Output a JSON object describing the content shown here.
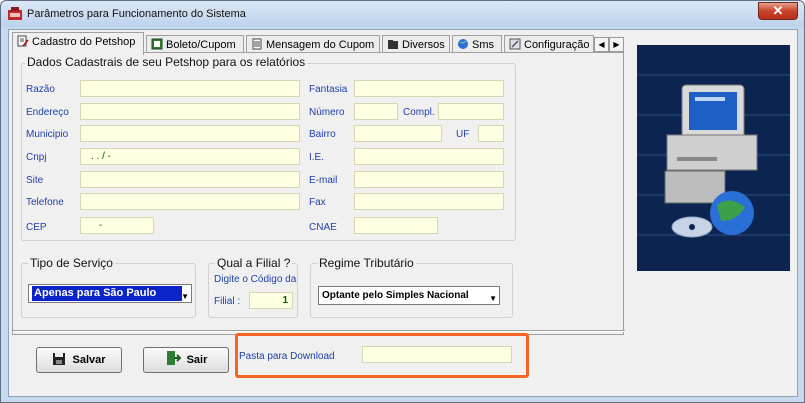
{
  "window": {
    "title": "Parâmetros para Funcionamento do Sistema",
    "close_label": "✕"
  },
  "tabs": [
    {
      "label": "Cadastro do Petshop",
      "icon": "document-pen-icon"
    },
    {
      "label": "Boleto/Cupom",
      "icon": "receipt-icon"
    },
    {
      "label": "Mensagem do Cupom",
      "icon": "note-icon"
    },
    {
      "label": "Diversos",
      "icon": "folder-icon"
    },
    {
      "label": "Sms",
      "icon": "globe-icon"
    },
    {
      "label": "Configuração I",
      "icon": "tools-icon"
    }
  ],
  "cadastro": {
    "group_title": "Dados Cadastrais de seu Petshop para os relatórios",
    "razao_label": "Razão",
    "endereco_label": "Endereço",
    "municipio_label": "Municipio",
    "cnpj_label": "Cnpj",
    "cnpj_value": ".   .   /   -",
    "site_label": "Site",
    "telefone_label": "Telefone",
    "cep_label": "CEP",
    "cep_value": "-",
    "fantasia_label": "Fantasia",
    "numero_label": "Número",
    "compl_label": "Compl.",
    "bairro_label": "Bairro",
    "uf_label": "UF",
    "ie_label": "I.E.",
    "email_label": "E-mail",
    "fax_label": "Fax",
    "cnae_label": "CNAE"
  },
  "servico": {
    "title": "Tipo de Serviço",
    "selected": "Apenas para São Paulo"
  },
  "filial": {
    "title": "Qual a Filial ?",
    "hint": "Digite o Código da",
    "label": "Filial :",
    "value": "1"
  },
  "regime": {
    "title": "Regime Tributário",
    "selected": "Optante pelo Simples Nacional"
  },
  "buttons": {
    "save": "Salvar",
    "exit": "Sair"
  },
  "download": {
    "label": "Pasta para Download"
  },
  "colors": {
    "highlight": "#f26522",
    "field_bg": "#ffffe1",
    "label_blue": "#1f3fa8"
  }
}
